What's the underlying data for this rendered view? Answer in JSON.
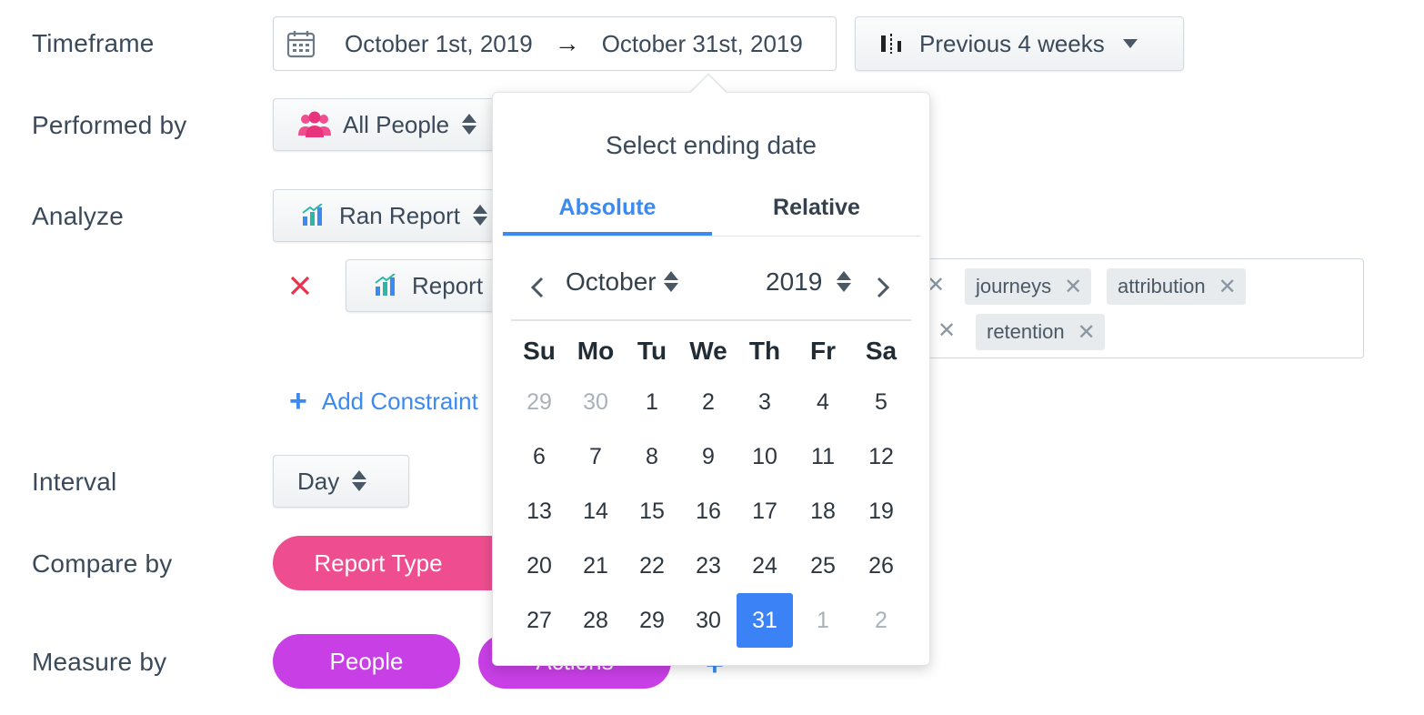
{
  "labels": {
    "timeframe": "Timeframe",
    "performed_by": "Performed by",
    "analyze": "Analyze",
    "interval": "Interval",
    "compare_by": "Compare by",
    "measure_by": "Measure by"
  },
  "timeframe": {
    "start": "October 1st, 2019",
    "arrow": "→",
    "end": "October 31st, 2019",
    "preset": "Previous 4 weeks"
  },
  "performed_by": {
    "value": "All People"
  },
  "analyze": {
    "event": "Ran Report",
    "property": "Report",
    "add_constraint": "Add Constraint"
  },
  "tags": [
    {
      "label": "journeys"
    },
    {
      "label": "attribution"
    },
    {
      "label": "retention"
    }
  ],
  "interval": {
    "value": "Day"
  },
  "compare_by": {
    "value": "Report Type"
  },
  "measure_by": {
    "people": "People",
    "actions": "Actions"
  },
  "colors": {
    "accent_blue": "#3b8af2",
    "pink_pill": "#ee4e8f",
    "magenta_pill": "#c83fe6",
    "remove_red": "#e8334a"
  },
  "datepicker": {
    "title": "Select ending date",
    "tabs": [
      "Absolute",
      "Relative"
    ],
    "active_tab": "Absolute",
    "month": "October",
    "year": "2019",
    "weekdays": [
      "Su",
      "Mo",
      "Tu",
      "We",
      "Th",
      "Fr",
      "Sa"
    ],
    "weeks": [
      [
        "29",
        "30",
        "1",
        "2",
        "3",
        "4",
        "5"
      ],
      [
        "6",
        "7",
        "8",
        "9",
        "10",
        "11",
        "12"
      ],
      [
        "13",
        "14",
        "15",
        "16",
        "17",
        "18",
        "19"
      ],
      [
        "20",
        "21",
        "22",
        "23",
        "24",
        "25",
        "26"
      ],
      [
        "27",
        "28",
        "29",
        "30",
        "31",
        "1",
        "2"
      ]
    ],
    "selected_day": "31"
  }
}
